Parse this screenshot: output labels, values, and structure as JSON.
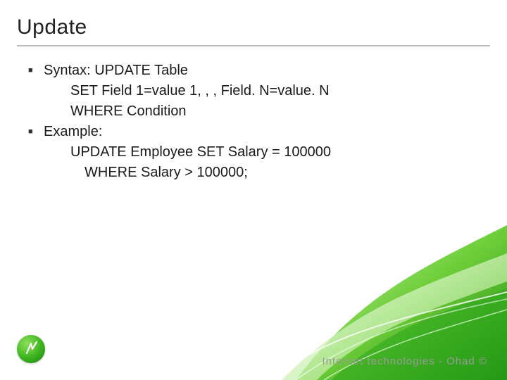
{
  "title": "Update",
  "bullets": [
    {
      "label": "Syntax:  UPDATE Table",
      "sub": [
        "SET Field 1=value 1, , , Field. N=value. N",
        "WHERE Condition"
      ]
    },
    {
      "label": "Example:",
      "sub": [
        "UPDATE Employee SET Salary = 100000",
        "WHERE Salary > 100000;"
      ],
      "sub_indent": [
        1,
        2
      ]
    }
  ],
  "footer": "Internet  technologies - Ohad ©",
  "colors": {
    "accent_green_light": "#7fd94a",
    "accent_green_dark": "#1f8a12"
  }
}
